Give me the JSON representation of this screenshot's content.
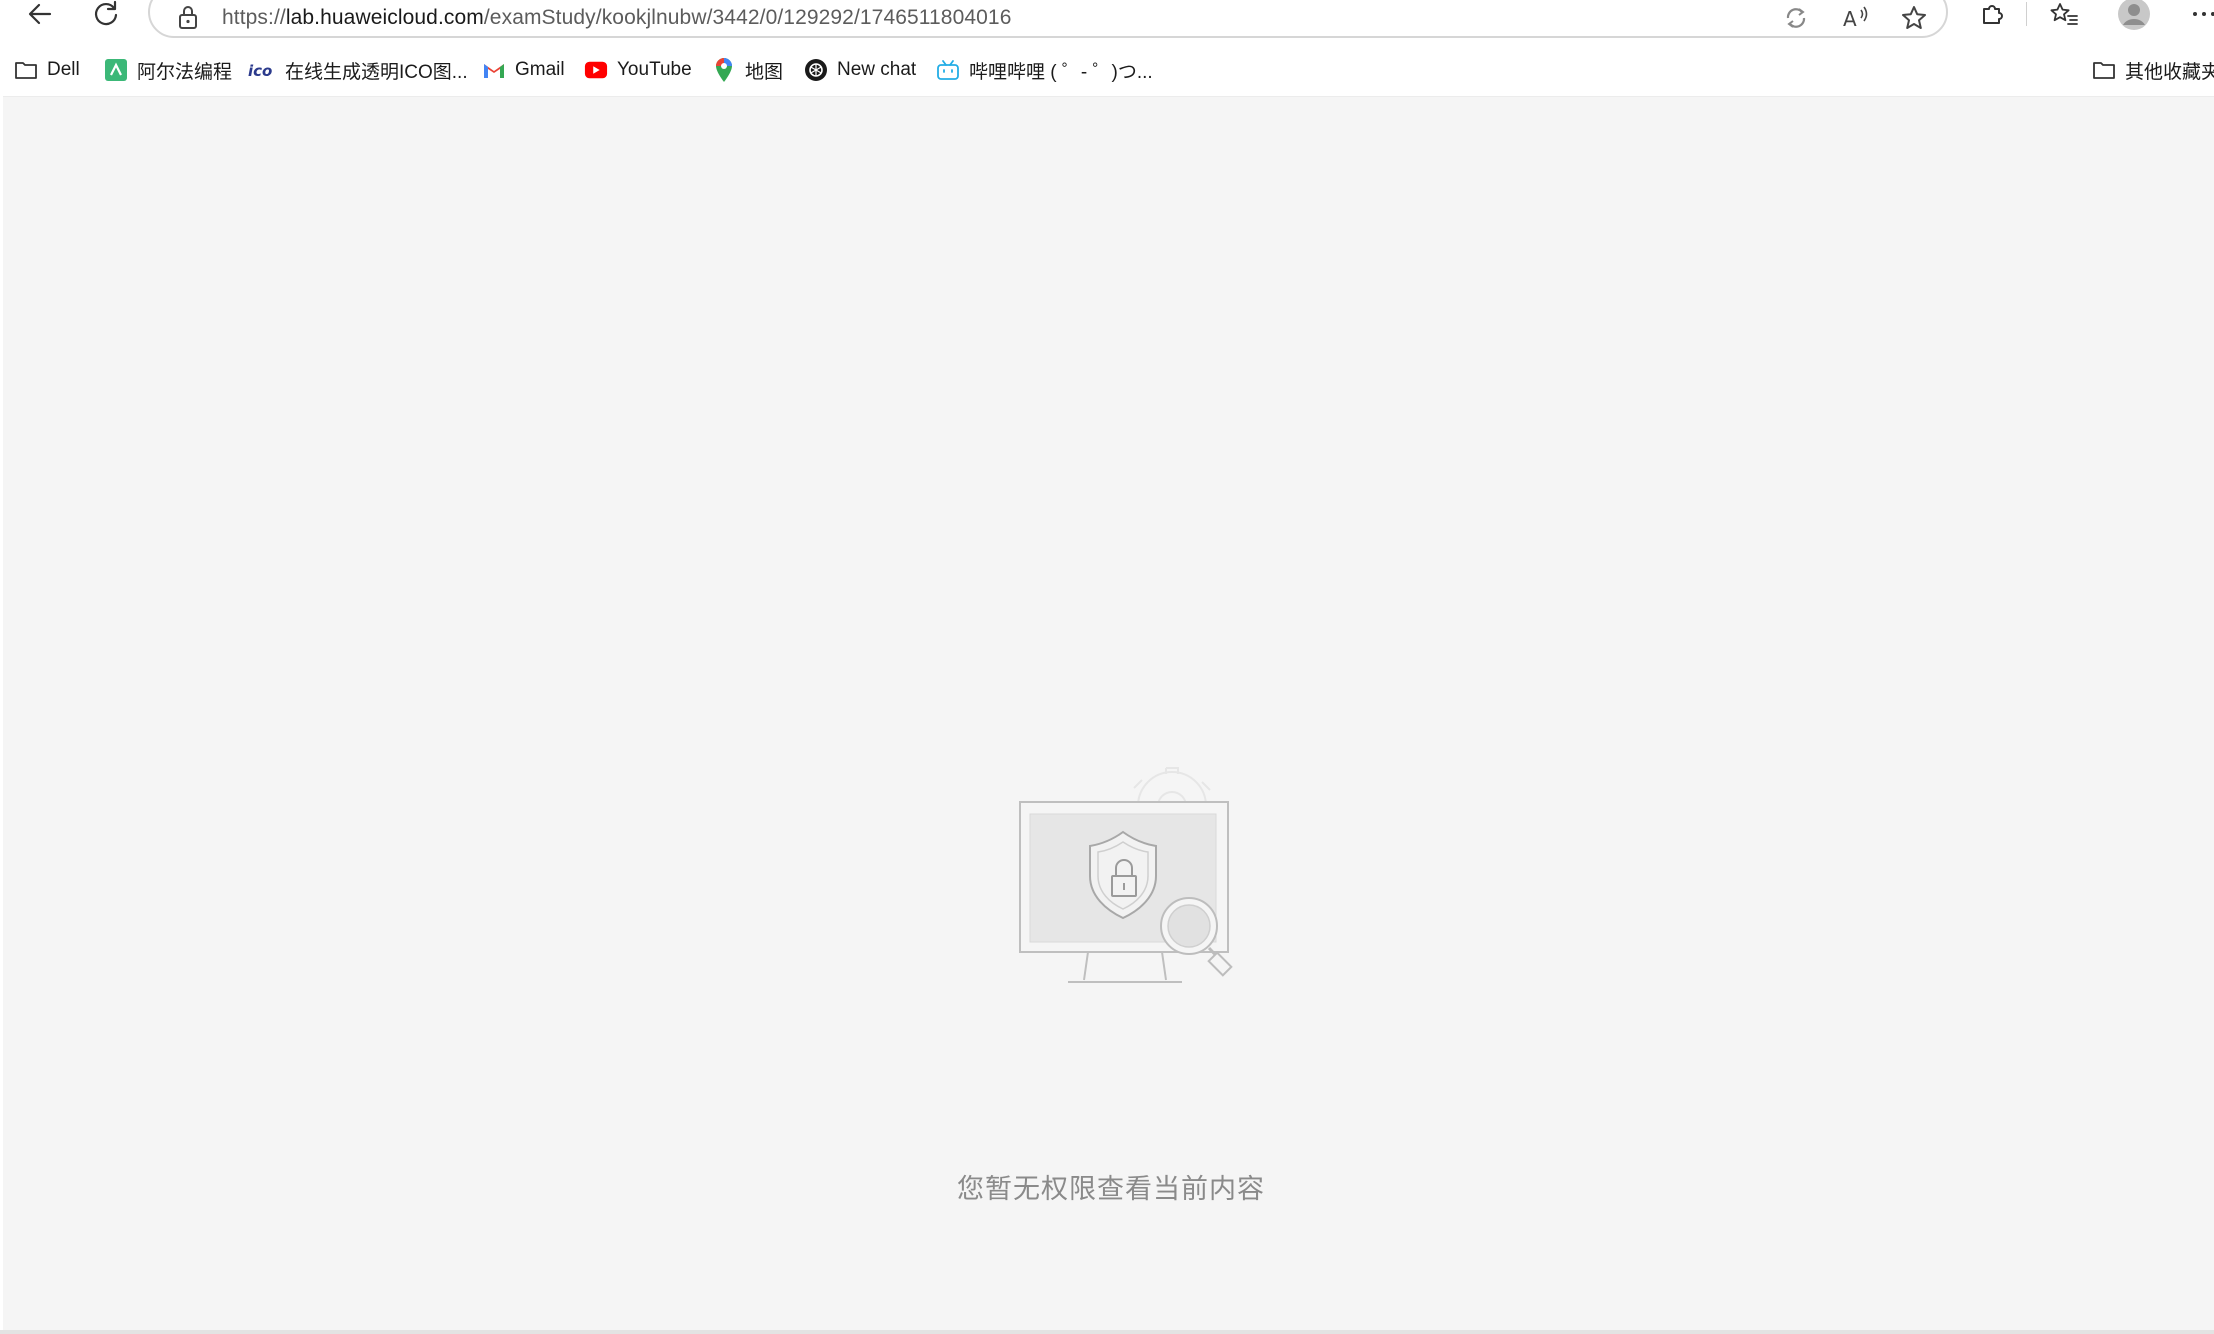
{
  "browser": {
    "url_scheme": "https://",
    "url_host": "lab.huaweicloud.com",
    "url_path": "/examStudy/kookjlnubw/3442/0/129292/1746511804016",
    "icons": {
      "back": "back-arrow-icon",
      "refresh": "refresh-icon",
      "lock": "lock-icon",
      "reader": "immersive-reader-icon",
      "read_aloud": "read-aloud-icon",
      "favorite": "star-icon",
      "extensions": "extensions-icon",
      "favorites_list": "favorites-icon",
      "profile": "profile-avatar-icon",
      "more": "more-icon"
    }
  },
  "bookmarks": {
    "items": [
      {
        "label": "Dell",
        "icon": "folder-icon"
      },
      {
        "label": "阿尔法编程",
        "icon": "alpha-coding-icon"
      },
      {
        "label": "在线生成透明ICO图...",
        "icon": "ico-icon"
      },
      {
        "label": "Gmail",
        "icon": "gmail-icon"
      },
      {
        "label": "YouTube",
        "icon": "youtube-icon"
      },
      {
        "label": "地图",
        "icon": "maps-pin-icon"
      },
      {
        "label": "New chat",
        "icon": "openai-icon"
      },
      {
        "label": "哔哩哔哩 ( ゜- ゜)つ...",
        "icon": "bilibili-icon"
      }
    ],
    "other_folder": {
      "label": "其他收藏夹",
      "icon": "folder-icon"
    }
  },
  "content": {
    "empty_message": "您暂无权限查看当前内容",
    "illustration": "no-permission-illustration"
  }
}
